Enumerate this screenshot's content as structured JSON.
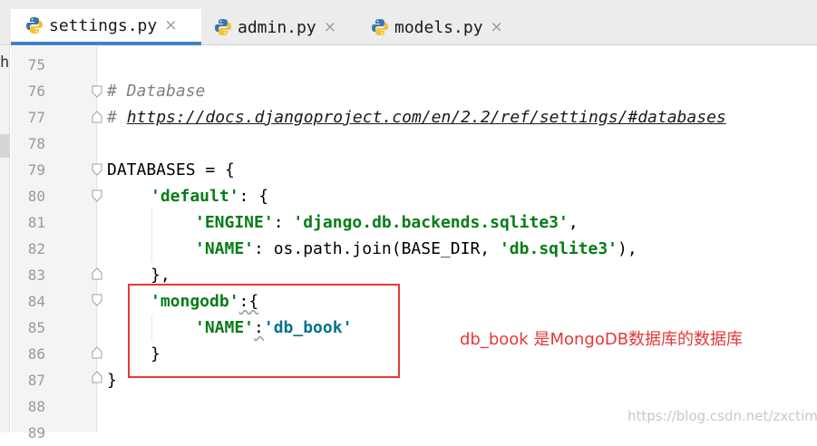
{
  "tabs": [
    {
      "label": "settings.py",
      "active": true
    },
    {
      "label": "admin.py",
      "active": false
    },
    {
      "label": "models.py",
      "active": false
    }
  ],
  "close_glyph": "×",
  "left_stub": "h",
  "line_numbers": [
    "75",
    "76",
    "77",
    "78",
    "79",
    "80",
    "81",
    "82",
    "83",
    "84",
    "85",
    "86",
    "87",
    "88",
    "89"
  ],
  "code": {
    "l76_comment": "# Database",
    "l77_hash": "# ",
    "l77_url": "https://docs.djangoproject.com/en/2.2/ref/settings/#databases",
    "l79": "DATABASES = {",
    "l80_key": "'default'",
    "l80_rest": ": {",
    "l81_key": "'ENGINE'",
    "l81_mid": ": ",
    "l81_val": "'django.db.backends.sqlite3'",
    "l81_end": ",",
    "l82_key": "'NAME'",
    "l82_mid": ": os.path.join(BASE_DIR, ",
    "l82_val": "'db.sqlite3'",
    "l82_end": "),",
    "l83": "},",
    "l84_key": "'mongodb'",
    "l84_rest": ":{",
    "l85_key": "'NAME'",
    "l85_mid": ":",
    "l85_val": "'db_book'",
    "l86": "}",
    "l87": "}"
  },
  "annotation": "db_book 是MongoDB数据库的数据库",
  "watermark": "https://blog.csdn.net/zxctime",
  "colors": {
    "tab_accent": "#4083c9",
    "annotation_red": "#e53935",
    "string_green": "#067d17",
    "key_teal": "#08718a"
  }
}
